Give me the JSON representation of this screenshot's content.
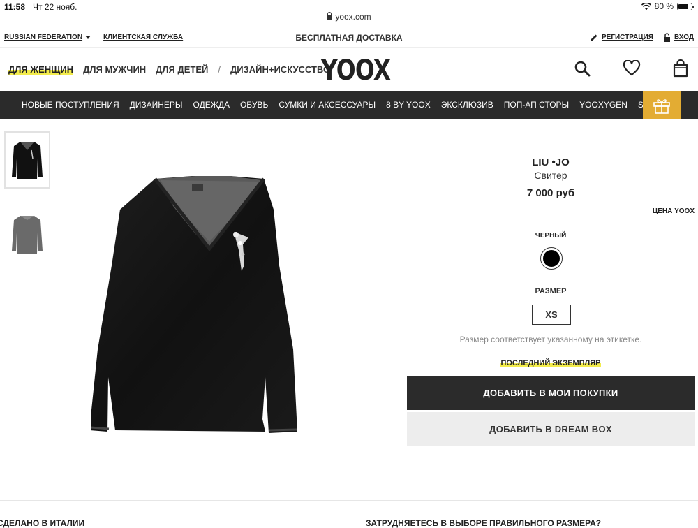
{
  "statusbar": {
    "time": "11:58",
    "date": "Чт 22 нояб.",
    "battery": "80 %",
    "battery_level": 0.8
  },
  "browser": {
    "url": "yoox.com"
  },
  "util": {
    "country": "RUSSIAN FEDERATION",
    "service": "КЛИЕНТСКАЯ СЛУЖБА",
    "promo": "БЕСПЛАТНАЯ ДОСТАВКА",
    "register": "РЕГИСТРАЦИЯ",
    "login": "ВХОД"
  },
  "header": {
    "cat_women": "ДЛЯ ЖЕНЩИН",
    "cat_men": "ДЛЯ МУЖЧИН",
    "cat_kids": "ДЛЯ ДЕТЕЙ",
    "slash": "/",
    "cat_design": "ДИЗАЙН+ИСКУССТВО",
    "logo": "YOOX",
    "icons": [
      "search-icon",
      "heart-icon",
      "shopping-bag-icon"
    ]
  },
  "nav": {
    "items": [
      "НОВЫЕ ПОСТУПЛЕНИЯ",
      "ДИЗАЙНЕРЫ",
      "ОДЕЖДА",
      "ОБУВЬ",
      "СУМКИ И АКСЕССУАРЫ",
      "8 BY YOOX",
      "ЭКСКЛЮЗИВ",
      "ПОП-АП СТОРЫ",
      "YOOXYGEN",
      "SALE"
    ],
    "gift_icon": "gift-icon",
    "gift_color": "#e3ac33",
    "bar_color": "#2b2b2b"
  },
  "product": {
    "brand": "LIU •JO",
    "type": "Свитер",
    "price": "7 000 руб",
    "price_link": "ЦЕНА YOOX",
    "color_label": "ЧЕРНЫЙ",
    "color_hex": "#000000",
    "size_label": "РАЗМЕР",
    "size": "XS",
    "size_note": "Размер соответствует указанному на этикетке.",
    "stock_note": "ПОСЛЕДНИЙ ЭКЗЕМПЛЯР",
    "buy_button": "ДОБАВИТЬ В МОИ ПОКУПКИ",
    "dreambox_button": "ДОБАВИТЬ В DREAM BOX"
  },
  "footer": {
    "left": "СДЕЛАНО В ИТАЛИИ",
    "right": "ЗАТРУДНЯЕТЕСЬ В ВЫБОРЕ ПРАВИЛЬНОГО РАЗМЕРА?"
  }
}
